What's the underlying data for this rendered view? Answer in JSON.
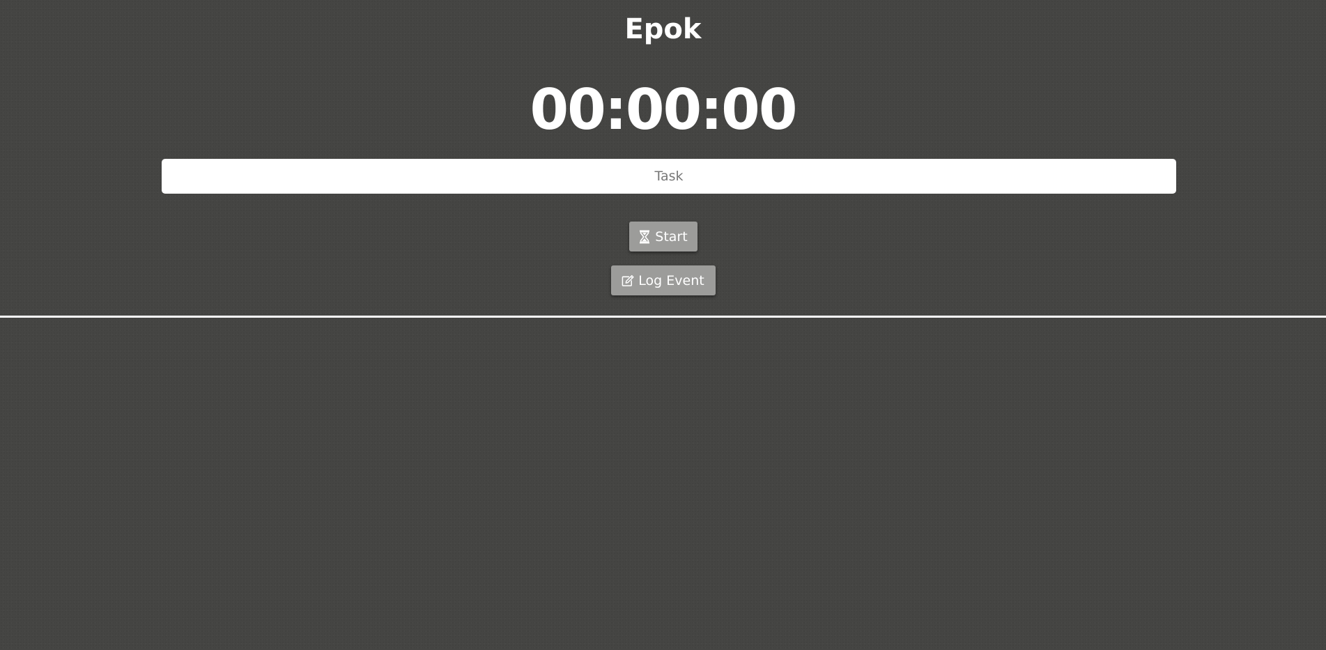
{
  "app": {
    "title": "Epok"
  },
  "timer": {
    "display": "00:00:00"
  },
  "task_input": {
    "value": "",
    "placeholder": "Task"
  },
  "buttons": {
    "start": {
      "label": "Start",
      "icon": "hourglass-icon"
    },
    "log_event": {
      "label": "Log Event",
      "icon": "edit-icon"
    }
  },
  "colors": {
    "background": "#454543",
    "button_bg": "#9c9c9a",
    "text": "#ffffff",
    "divider": "#ffffff"
  }
}
